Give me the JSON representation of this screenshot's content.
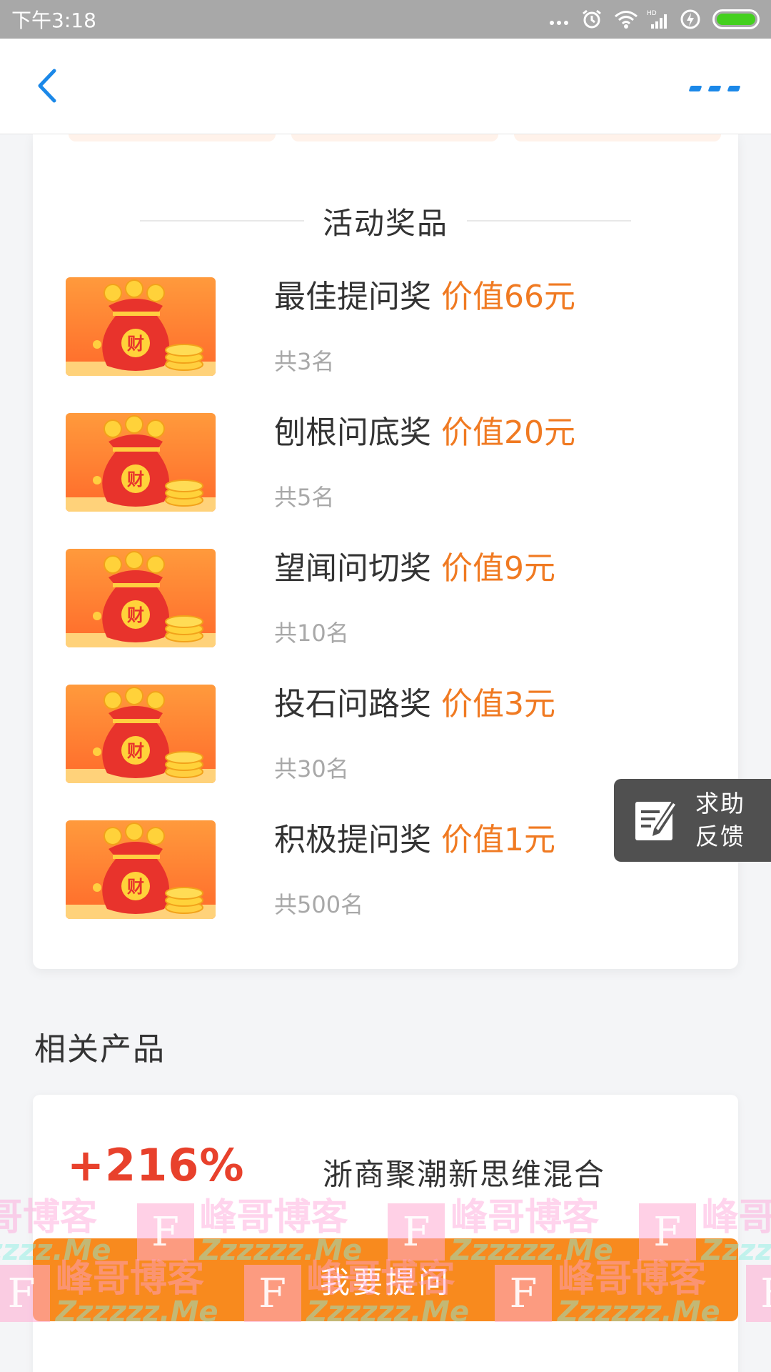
{
  "status_bar": {
    "time": "下午3:18",
    "icons": [
      "more-dots-icon",
      "alarm-icon",
      "wifi-icon",
      "hd-signal-icon",
      "charging-icon",
      "battery-icon"
    ],
    "battery_color": "#44d01e"
  },
  "nav": {
    "back_icon": "chevron-left-icon",
    "more_icon": "more-icon",
    "accent": "#1b88e8"
  },
  "prizes": {
    "title": "活动奖品",
    "items": [
      {
        "name": "最佳提问奖",
        "value": "价值66元",
        "count": "共3名"
      },
      {
        "name": "刨根问底奖",
        "value": "价值20元",
        "count": "共5名"
      },
      {
        "name": "望闻问切奖",
        "value": "价值9元",
        "count": "共10名"
      },
      {
        "name": "投石问路奖",
        "value": "价值3元",
        "count": "共30名"
      },
      {
        "name": "积极提问奖",
        "value": "价值1元",
        "count": "共500名"
      }
    ],
    "thumb_glyph": "财",
    "value_color": "#f07a22"
  },
  "related": {
    "title": "相关产品",
    "product": {
      "rate": "+216%",
      "name": "浙商聚潮新思维混合",
      "rate_color": "#e8412c"
    }
  },
  "help_float": {
    "line1": "求助",
    "line2": "反馈",
    "icon": "edit-note-icon"
  },
  "ask_button": {
    "label": "我要提问",
    "color": "#f88a1e"
  },
  "watermark": {
    "cn": "峰哥博客",
    "en": "Zzzzzz.Me",
    "mark": "F"
  }
}
